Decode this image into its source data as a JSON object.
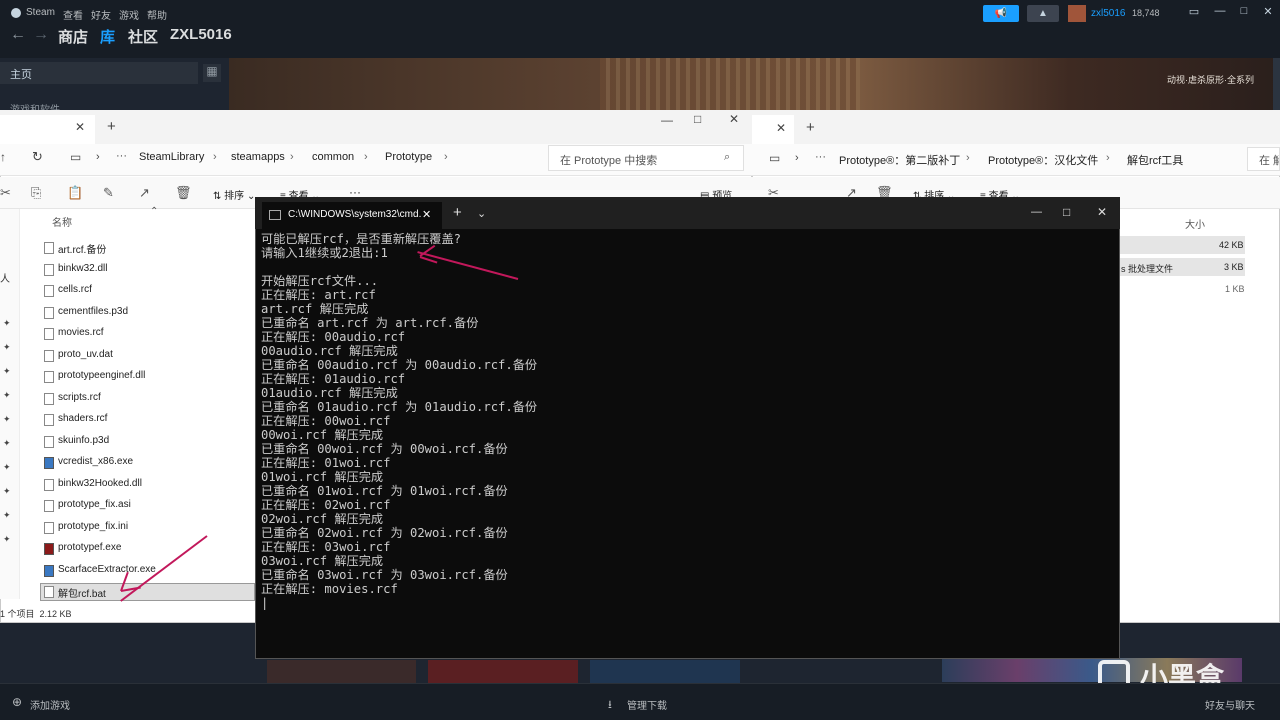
{
  "steam": {
    "brand": "Steam",
    "menu": [
      "查看",
      "好友",
      "游戏",
      "帮助"
    ],
    "nav": {
      "store": "商店",
      "library": "库",
      "community": "社区",
      "user": "ZXL5016"
    },
    "account": {
      "name": "zxl5016",
      "balance": "18,748"
    },
    "sidebar_home": "主页",
    "sidebar_filter": "游戏和软件",
    "banner_text": "动视·虐杀原形·全系列",
    "bottom": {
      "add_game": "添加游戏",
      "downloads": "管理下载",
      "friends": "好友与聊天"
    },
    "watermark": "小黑盒"
  },
  "explorer_left": {
    "breadcrumb": [
      "SteamLibrary",
      "steamapps",
      "common",
      "Prototype"
    ],
    "search_placeholder": "在 Prototype 中搜索",
    "toolbar": {
      "sort": "排序",
      "view": "查看",
      "more": "···",
      "preview": "预览"
    },
    "column_name": "名称",
    "files": [
      "art.rcf.备份",
      "binkw32.dll",
      "cells.rcf",
      "cementfiles.p3d",
      "movies.rcf",
      "proto_uv.dat",
      "prototypeenginef.dll",
      "scripts.rcf",
      "shaders.rcf",
      "skuinfo.p3d",
      "vcredist_x86.exe",
      "binkw32Hooked.dll",
      "prototype_fix.asi",
      "prototype_fix.ini",
      "prototypef.exe",
      "ScarfaceExtractor.exe",
      "解包rcf.bat"
    ],
    "status": "1 个项目  2.12 KB",
    "left_char": "人"
  },
  "explorer_right": {
    "breadcrumb": [
      "Prototype®：第二版补丁",
      "Prototype®：汉化文件",
      "解包rcf工具"
    ],
    "search_placeholder": "在 解",
    "toolbar": {
      "sort": "排序",
      "view": "查看"
    },
    "column_size": "大小",
    "rows": [
      {
        "type": "",
        "size": "42 KB"
      },
      {
        "type": "s 批处理文件",
        "size": "3 KB"
      },
      {
        "type": "",
        "size": "1 KB"
      }
    ]
  },
  "cmd": {
    "tab_title": "C:\\WINDOWS\\system32\\cmd.",
    "output": "可能已解压rcf，是否重新解压覆盖?\n请输入1继续或2退出:1\n\n开始解压rcf文件...\n正在解压: art.rcf\nart.rcf 解压完成\n已重命名 art.rcf 为 art.rcf.备份\n正在解压: 00audio.rcf\n00audio.rcf 解压完成\n已重命名 00audio.rcf 为 00audio.rcf.备份\n正在解压: 01audio.rcf\n01audio.rcf 解压完成\n已重命名 01audio.rcf 为 01audio.rcf.备份\n正在解压: 00woi.rcf\n00woi.rcf 解压完成\n已重命名 00woi.rcf 为 00woi.rcf.备份\n正在解压: 01woi.rcf\n01woi.rcf 解压完成\n已重命名 01woi.rcf 为 01woi.rcf.备份\n正在解压: 02woi.rcf\n02woi.rcf 解压完成\n已重命名 02woi.rcf 为 02woi.rcf.备份\n正在解压: 03woi.rcf\n03woi.rcf 解压完成\n已重命名 03woi.rcf 为 03woi.rcf.备份\n正在解压: movies.rcf\n|"
  },
  "colors": {
    "annotation": "#c2185b",
    "steam_bg": "#171d25",
    "cmd_bg": "#0c0c0c",
    "steam_accent": "#1a9fff"
  }
}
